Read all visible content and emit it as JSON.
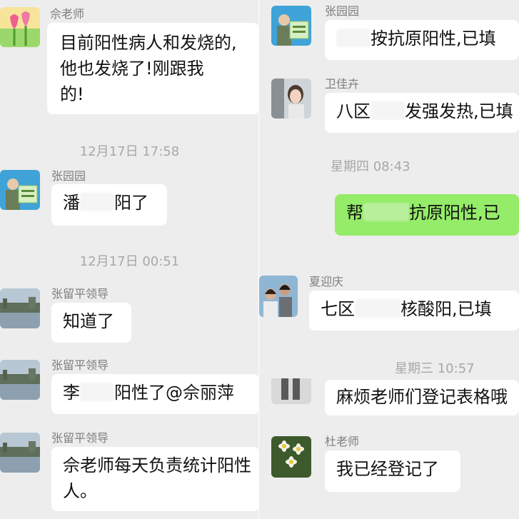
{
  "left": {
    "messages": [
      {
        "sender": "佘老师",
        "lines": [
          "目前阳性病人和发烧的,",
          "他也发烧了!刚跟我",
          "的!"
        ]
      },
      {
        "timestamp": "12月17日 17:58"
      },
      {
        "sender": "张园园",
        "text_before": "潘",
        "text_after": "阳了"
      },
      {
        "timestamp": "12月17日 00:51"
      },
      {
        "sender": "张留平领导",
        "text": "知道了"
      },
      {
        "sender": "张留平领导",
        "text_before": "李",
        "text_after": "阳性了@佘丽萍"
      },
      {
        "sender": "张留平领导",
        "lines": [
          "佘老师每天负责统计阳性",
          "人。"
        ]
      }
    ]
  },
  "right": {
    "messages": [
      {
        "sender": "张园园",
        "text_after": "按抗原阳性,已填"
      },
      {
        "sender": "卫佳卉",
        "text_before": "八区",
        "text_after": "发强发热,已填"
      },
      {
        "timestamp": "星期四 08:43"
      },
      {
        "sender": "",
        "text_before": "帮",
        "text_after": "抗原阳性,已"
      },
      {
        "sender": "夏迎庆",
        "text_before": "七区",
        "text_after": "核酸阳,已填"
      },
      {
        "timestamp": "星期三 10:57"
      },
      {
        "sender": "",
        "text": "麻烦老师们登记表格哦"
      },
      {
        "sender": "杜老师",
        "text": "我已经登记了"
      }
    ]
  },
  "colors": {
    "background": "#ededed",
    "bubble": "#ffffff",
    "bubble_self": "#95ec69",
    "name_text": "#7d7d7d",
    "timestamp_text": "#a8a8a8"
  },
  "icons": [
    "tulip-avatar-icon",
    "elder-with-sign-avatar-icon",
    "girl-portrait-avatar-icon",
    "couple-avatar-icon",
    "river-city-avatar-icon",
    "daisy-flower-avatar-icon"
  ]
}
